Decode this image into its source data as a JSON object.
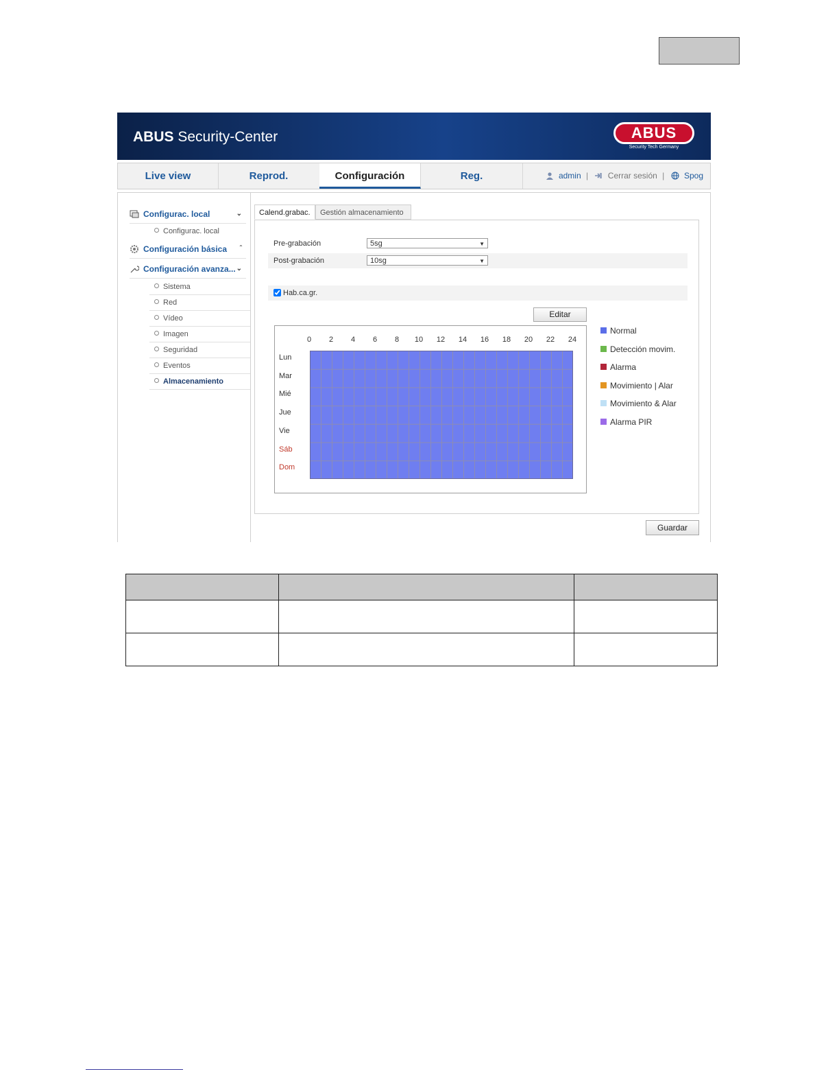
{
  "app": {
    "brand_bold": "ABUS",
    "brand_rest": " Security-Center",
    "logo_text": "ABUS",
    "logo_sub": "Security Tech Germany"
  },
  "nav": {
    "tabs": [
      {
        "label": "Live view"
      },
      {
        "label": "Reprod."
      },
      {
        "label": "Configuración",
        "active": true
      },
      {
        "label": "Reg."
      }
    ],
    "user": "admin",
    "logout": "Cerrar sesión",
    "language": "Spog"
  },
  "sidebar": {
    "sections": [
      {
        "label": "Configurac. local",
        "items": [
          "Configurac. local"
        ]
      },
      {
        "label": "Configuración básica",
        "items": []
      },
      {
        "label": "Configuración avanza...",
        "items": [
          "Sistema",
          "Red",
          "Vídeo",
          "Imagen",
          "Seguridad",
          "Eventos",
          "Almacenamiento"
        ]
      }
    ],
    "active_item": "Almacenamiento"
  },
  "tabs": {
    "schedule": "Calend.grabac.",
    "storage": "Gestión almacenamiento"
  },
  "form": {
    "pre_label": "Pre-grabación",
    "pre_value": "5sg",
    "post_label": "Post-grabación",
    "post_value": "10sg",
    "enable_label": "Hab.ca.gr.",
    "enable_checked": true,
    "edit_button": "Editar",
    "save_button": "Guardar"
  },
  "schedule": {
    "hours": [
      "0",
      "2",
      "4",
      "6",
      "8",
      "10",
      "12",
      "14",
      "16",
      "18",
      "20",
      "22",
      "24"
    ],
    "days": [
      "Lun",
      "Mar",
      "Mié",
      "Jue",
      "Vie",
      "Sáb",
      "Dom"
    ],
    "weekend_days": [
      "Sáb",
      "Dom"
    ],
    "fill_type": "Normal",
    "fill_color": "#6f7ef0"
  },
  "legend": [
    {
      "label": "Normal",
      "color": "#5b6ee8"
    },
    {
      "label": "Detección movim.",
      "color": "#6cb84c"
    },
    {
      "label": "Alarma",
      "color": "#b2263a"
    },
    {
      "label": "Movimiento | Alar",
      "color": "#e39522"
    },
    {
      "label": "Movimiento & Alar",
      "color": "#bfe0f5"
    },
    {
      "label": "Alarma PIR",
      "color": "#9b6be8"
    }
  ]
}
